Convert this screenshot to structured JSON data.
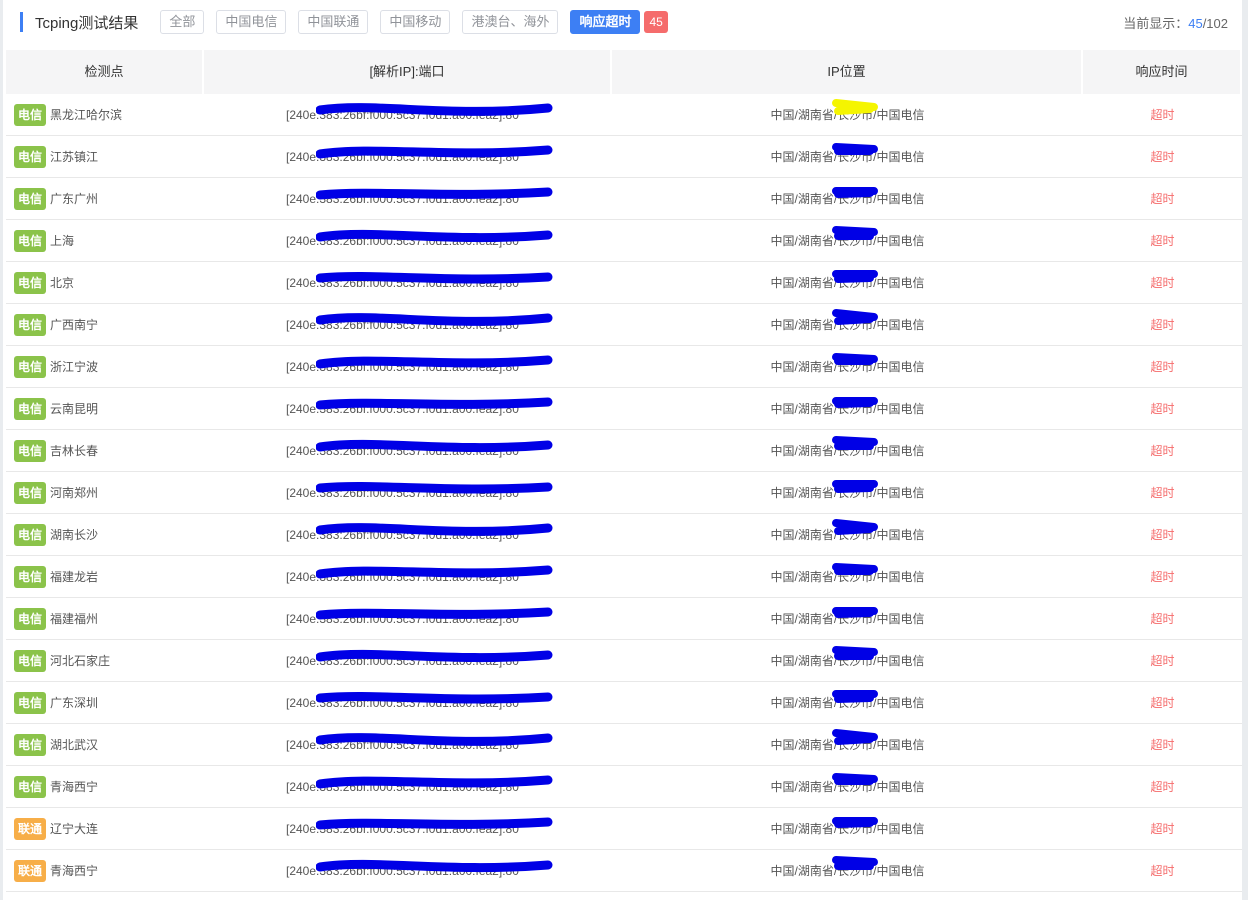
{
  "header": {
    "title": "Tcping测试结果",
    "filters": [
      "全部",
      "中国电信",
      "中国联通",
      "中国移动",
      "港澳台、海外"
    ],
    "active_filter": "响应超时",
    "active_count": "45",
    "showing_label": "当前显示：",
    "showing_current": "45",
    "showing_total": "/102"
  },
  "columns": [
    "检测点",
    "[解析IP]:端口",
    "IP位置",
    "响应时间"
  ],
  "colors": {
    "accent": "#3d7ff4",
    "telecom_tag": "#8bc34a",
    "unicom_tag": "#f7ae48",
    "timeout_text": "#f56c6c",
    "redaction": "#0000e6",
    "highlight": "#f5f500"
  },
  "rows": [
    {
      "isp": "电信",
      "location": "黑龙江哈尔滨",
      "ip": "[240e:383:26bf:f000:5c37:f0d1:a00:fea2]:80",
      "geo": "中国/湖南省/长沙市/中国电信",
      "time": "超时"
    },
    {
      "isp": "电信",
      "location": "江苏镇江",
      "ip": "[240e:383:26bf:f000:5c37:f0d1:a00:fea2]:80",
      "geo": "中国/湖南省/长沙市/中国电信",
      "time": "超时"
    },
    {
      "isp": "电信",
      "location": "广东广州",
      "ip": "[240e:383:26bf:f000:5c37:f0d1:a00:fea2]:80",
      "geo": "中国/湖南省/长沙市/中国电信",
      "time": "超时"
    },
    {
      "isp": "电信",
      "location": "上海",
      "ip": "[240e:383:26bf:f000:5c37:f0d1:a00:fea2]:80",
      "geo": "中国/湖南省/长沙市/中国电信",
      "time": "超时"
    },
    {
      "isp": "电信",
      "location": "北京",
      "ip": "[240e:383:26bf:f000:5c37:f0d1:a00:fea2]:80",
      "geo": "中国/湖南省/长沙市/中国电信",
      "time": "超时"
    },
    {
      "isp": "电信",
      "location": "广西南宁",
      "ip": "[240e:383:26bf:f000:5c37:f0d1:a00:fea2]:80",
      "geo": "中国/湖南省/长沙市/中国电信",
      "time": "超时"
    },
    {
      "isp": "电信",
      "location": "浙江宁波",
      "ip": "[240e:383:26bf:f000:5c37:f0d1:a00:fea2]:80",
      "geo": "中国/湖南省/长沙市/中国电信",
      "time": "超时"
    },
    {
      "isp": "电信",
      "location": "云南昆明",
      "ip": "[240e:383:26bf:f000:5c37:f0d1:a00:fea2]:80",
      "geo": "中国/湖南省/长沙市/中国电信",
      "time": "超时"
    },
    {
      "isp": "电信",
      "location": "吉林长春",
      "ip": "[240e:383:26bf:f000:5c37:f0d1:a00:fea2]:80",
      "geo": "中国/湖南省/长沙市/中国电信",
      "time": "超时"
    },
    {
      "isp": "电信",
      "location": "河南郑州",
      "ip": "[240e:383:26bf:f000:5c37:f0d1:a00:fea2]:80",
      "geo": "中国/湖南省/长沙市/中国电信",
      "time": "超时"
    },
    {
      "isp": "电信",
      "location": "湖南长沙",
      "ip": "[240e:383:26bf:f000:5c37:f0d1:a00:fea2]:80",
      "geo": "中国/湖南省/长沙市/中国电信",
      "time": "超时"
    },
    {
      "isp": "电信",
      "location": "福建龙岩",
      "ip": "[240e:383:26bf:f000:5c37:f0d1:a00:fea2]:80",
      "geo": "中国/湖南省/长沙市/中国电信",
      "time": "超时"
    },
    {
      "isp": "电信",
      "location": "福建福州",
      "ip": "[240e:383:26bf:f000:5c37:f0d1:a00:fea2]:80",
      "geo": "中国/湖南省/长沙市/中国电信",
      "time": "超时"
    },
    {
      "isp": "电信",
      "location": "河北石家庄",
      "ip": "[240e:383:26bf:f000:5c37:f0d1:a00:fea2]:80",
      "geo": "中国/湖南省/长沙市/中国电信",
      "time": "超时"
    },
    {
      "isp": "电信",
      "location": "广东深圳",
      "ip": "[240e:383:26bf:f000:5c37:f0d1:a00:fea2]:80",
      "geo": "中国/湖南省/长沙市/中国电信",
      "time": "超时"
    },
    {
      "isp": "电信",
      "location": "湖北武汉",
      "ip": "[240e:383:26bf:f000:5c37:f0d1:a00:fea2]:80",
      "geo": "中国/湖南省/长沙市/中国电信",
      "time": "超时"
    },
    {
      "isp": "电信",
      "location": "青海西宁",
      "ip": "[240e:383:26bf:f000:5c37:f0d1:a00:fea2]:80",
      "geo": "中国/湖南省/长沙市/中国电信",
      "time": "超时"
    },
    {
      "isp": "联通",
      "location": "辽宁大连",
      "ip": "[240e:383:26bf:f000:5c37:f0d1:a00:fea2]:80",
      "geo": "中国/湖南省/长沙市/中国电信",
      "time": "超时"
    },
    {
      "isp": "联通",
      "location": "青海西宁",
      "ip": "[240e:383:26bf:f000:5c37:f0d1:a00:fea2]:80",
      "geo": "中国/湖南省/长沙市/中国电信",
      "time": "超时"
    }
  ]
}
